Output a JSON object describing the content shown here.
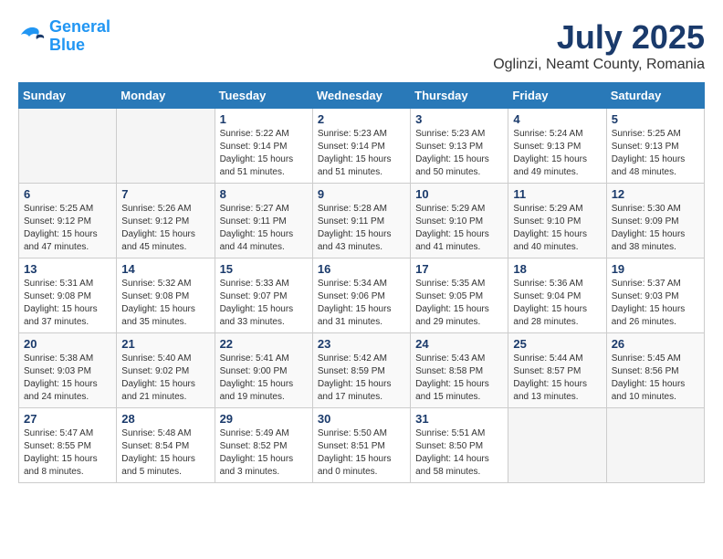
{
  "header": {
    "logo_line1": "General",
    "logo_line2": "Blue",
    "title": "July 2025",
    "subtitle": "Oglinzi, Neamt County, Romania"
  },
  "weekdays": [
    "Sunday",
    "Monday",
    "Tuesday",
    "Wednesday",
    "Thursday",
    "Friday",
    "Saturday"
  ],
  "weeks": [
    [
      {
        "day": "",
        "info": ""
      },
      {
        "day": "",
        "info": ""
      },
      {
        "day": "1",
        "info": "Sunrise: 5:22 AM\nSunset: 9:14 PM\nDaylight: 15 hours\nand 51 minutes."
      },
      {
        "day": "2",
        "info": "Sunrise: 5:23 AM\nSunset: 9:14 PM\nDaylight: 15 hours\nand 51 minutes."
      },
      {
        "day": "3",
        "info": "Sunrise: 5:23 AM\nSunset: 9:13 PM\nDaylight: 15 hours\nand 50 minutes."
      },
      {
        "day": "4",
        "info": "Sunrise: 5:24 AM\nSunset: 9:13 PM\nDaylight: 15 hours\nand 49 minutes."
      },
      {
        "day": "5",
        "info": "Sunrise: 5:25 AM\nSunset: 9:13 PM\nDaylight: 15 hours\nand 48 minutes."
      }
    ],
    [
      {
        "day": "6",
        "info": "Sunrise: 5:25 AM\nSunset: 9:12 PM\nDaylight: 15 hours\nand 47 minutes."
      },
      {
        "day": "7",
        "info": "Sunrise: 5:26 AM\nSunset: 9:12 PM\nDaylight: 15 hours\nand 45 minutes."
      },
      {
        "day": "8",
        "info": "Sunrise: 5:27 AM\nSunset: 9:11 PM\nDaylight: 15 hours\nand 44 minutes."
      },
      {
        "day": "9",
        "info": "Sunrise: 5:28 AM\nSunset: 9:11 PM\nDaylight: 15 hours\nand 43 minutes."
      },
      {
        "day": "10",
        "info": "Sunrise: 5:29 AM\nSunset: 9:10 PM\nDaylight: 15 hours\nand 41 minutes."
      },
      {
        "day": "11",
        "info": "Sunrise: 5:29 AM\nSunset: 9:10 PM\nDaylight: 15 hours\nand 40 minutes."
      },
      {
        "day": "12",
        "info": "Sunrise: 5:30 AM\nSunset: 9:09 PM\nDaylight: 15 hours\nand 38 minutes."
      }
    ],
    [
      {
        "day": "13",
        "info": "Sunrise: 5:31 AM\nSunset: 9:08 PM\nDaylight: 15 hours\nand 37 minutes."
      },
      {
        "day": "14",
        "info": "Sunrise: 5:32 AM\nSunset: 9:08 PM\nDaylight: 15 hours\nand 35 minutes."
      },
      {
        "day": "15",
        "info": "Sunrise: 5:33 AM\nSunset: 9:07 PM\nDaylight: 15 hours\nand 33 minutes."
      },
      {
        "day": "16",
        "info": "Sunrise: 5:34 AM\nSunset: 9:06 PM\nDaylight: 15 hours\nand 31 minutes."
      },
      {
        "day": "17",
        "info": "Sunrise: 5:35 AM\nSunset: 9:05 PM\nDaylight: 15 hours\nand 29 minutes."
      },
      {
        "day": "18",
        "info": "Sunrise: 5:36 AM\nSunset: 9:04 PM\nDaylight: 15 hours\nand 28 minutes."
      },
      {
        "day": "19",
        "info": "Sunrise: 5:37 AM\nSunset: 9:03 PM\nDaylight: 15 hours\nand 26 minutes."
      }
    ],
    [
      {
        "day": "20",
        "info": "Sunrise: 5:38 AM\nSunset: 9:03 PM\nDaylight: 15 hours\nand 24 minutes."
      },
      {
        "day": "21",
        "info": "Sunrise: 5:40 AM\nSunset: 9:02 PM\nDaylight: 15 hours\nand 21 minutes."
      },
      {
        "day": "22",
        "info": "Sunrise: 5:41 AM\nSunset: 9:00 PM\nDaylight: 15 hours\nand 19 minutes."
      },
      {
        "day": "23",
        "info": "Sunrise: 5:42 AM\nSunset: 8:59 PM\nDaylight: 15 hours\nand 17 minutes."
      },
      {
        "day": "24",
        "info": "Sunrise: 5:43 AM\nSunset: 8:58 PM\nDaylight: 15 hours\nand 15 minutes."
      },
      {
        "day": "25",
        "info": "Sunrise: 5:44 AM\nSunset: 8:57 PM\nDaylight: 15 hours\nand 13 minutes."
      },
      {
        "day": "26",
        "info": "Sunrise: 5:45 AM\nSunset: 8:56 PM\nDaylight: 15 hours\nand 10 minutes."
      }
    ],
    [
      {
        "day": "27",
        "info": "Sunrise: 5:47 AM\nSunset: 8:55 PM\nDaylight: 15 hours\nand 8 minutes."
      },
      {
        "day": "28",
        "info": "Sunrise: 5:48 AM\nSunset: 8:54 PM\nDaylight: 15 hours\nand 5 minutes."
      },
      {
        "day": "29",
        "info": "Sunrise: 5:49 AM\nSunset: 8:52 PM\nDaylight: 15 hours\nand 3 minutes."
      },
      {
        "day": "30",
        "info": "Sunrise: 5:50 AM\nSunset: 8:51 PM\nDaylight: 15 hours\nand 0 minutes."
      },
      {
        "day": "31",
        "info": "Sunrise: 5:51 AM\nSunset: 8:50 PM\nDaylight: 14 hours\nand 58 minutes."
      },
      {
        "day": "",
        "info": ""
      },
      {
        "day": "",
        "info": ""
      }
    ]
  ]
}
